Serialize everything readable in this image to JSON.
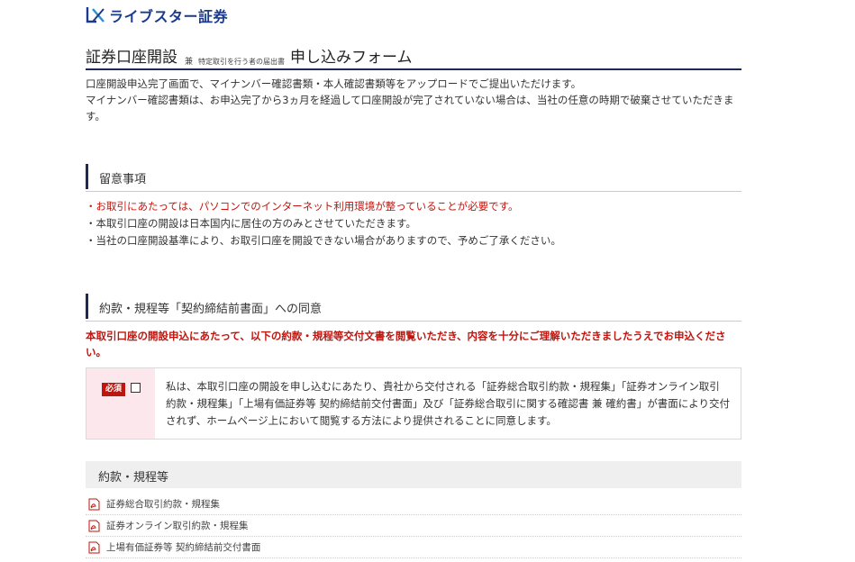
{
  "header": {
    "logo_text": "ライブスター証券"
  },
  "title": {
    "main": "証券口座開設",
    "and": "兼",
    "small": "特定取引を行う者の届出書",
    "form": "申し込みフォーム"
  },
  "intro": [
    "口座開設申込完了画面で、マイナンバー確認書類・本人確認書類等をアップロードでご提出いただけます。",
    "マイナンバー確認書類は、お申込完了から3ヵ月を経過して口座開設が完了されていない場合は、当社の任意の時期で破棄させていただきます。"
  ],
  "notice": {
    "heading": "留意事項",
    "items": [
      "・お取引にあたっては、パソコンでのインターネット利用環境が整っていることが必要です。",
      "・本取引口座の開設は日本国内に居住の方のみとさせていただきます。",
      "・当社の口座開設基準により、お取引口座を開設できない場合がありますので、予めご了承ください。"
    ]
  },
  "consent": {
    "heading": "約款・規程等「契約締結前書面」への同意",
    "warning": "本取引口座の開設申込にあたって、以下の約款・規程等交付文書を閲覧いただき、内容を十分にご理解いただきましたうえでお申込ください。",
    "required_label": "必須",
    "agreement_text": "私は、本取引口座の開設を申し込むにあたり、貴社から交付される「証券総合取引約款・規程集」「証券オンライン取引約款・規程集」「上場有価証券等 契約締結前交付書面」及び「証券総合取引に関する確認書 兼 確約書」が書面により交付されず、ホームページ上において閲覧する方法により提供されることに同意します。"
  },
  "documents": {
    "heading": "約款・規程等",
    "items": [
      "証券総合取引約款・規程集",
      "証券オンライン取引約款・規程集",
      "上場有価証券等 契約締結前交付書面"
    ]
  },
  "colors": {
    "brand": "#1a3a8c",
    "accent_bar": "#1e2a55",
    "warning": "#c0150e",
    "required_bg": "#fce8ec"
  }
}
